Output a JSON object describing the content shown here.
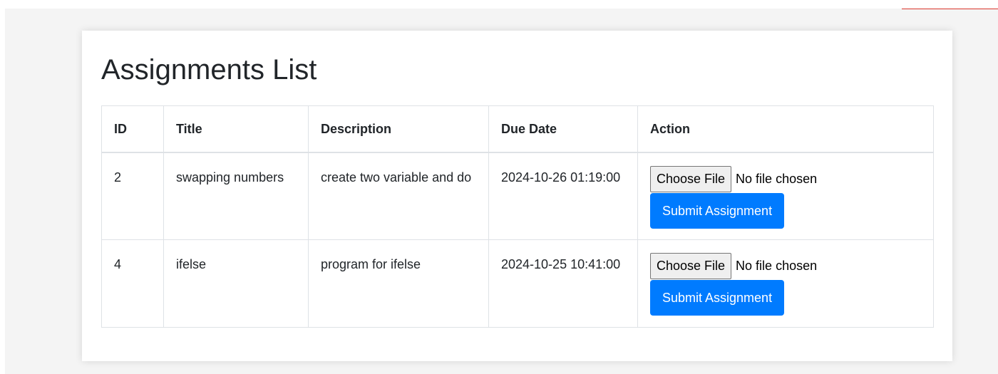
{
  "page": {
    "title": "Assignments List"
  },
  "table": {
    "headers": [
      "ID",
      "Title",
      "Description",
      "Due Date",
      "Action"
    ],
    "rows": [
      {
        "id": "2",
        "title": "swapping numbers",
        "description": "create two variable and do",
        "due_date": "2024-10-26 01:19:00",
        "file_button": "Choose File",
        "file_status": "No file chosen",
        "submit_label": "Submit Assignment"
      },
      {
        "id": "4",
        "title": "ifelse",
        "description": "program for ifelse",
        "due_date": "2024-10-25 10:41:00",
        "file_button": "Choose File",
        "file_status": "No file chosen",
        "submit_label": "Submit Assignment"
      }
    ]
  },
  "colors": {
    "primary": "#007bff",
    "accent_line": "#d9342b",
    "page_background": "#f4f4f4",
    "border": "#dee2e6"
  }
}
